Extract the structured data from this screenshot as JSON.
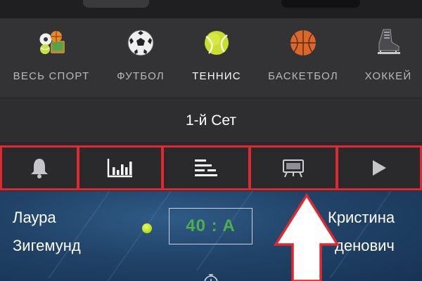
{
  "sports_nav": {
    "items": [
      {
        "label": "ВЕСЬ СПОРТ",
        "icon": "all-sports-icon"
      },
      {
        "label": "ФУТБОЛ",
        "icon": "soccer-ball-icon"
      },
      {
        "label": "ТЕННИС",
        "icon": "tennis-ball-icon",
        "active": true
      },
      {
        "label": "БАСКЕТБОЛ",
        "icon": "basketball-icon"
      },
      {
        "label": "ХОККЕЙ",
        "icon": "hockey-skate-icon"
      }
    ]
  },
  "set_bar": {
    "label": "1-й Сет"
  },
  "action_bar": {
    "items": [
      {
        "icon": "bell-icon"
      },
      {
        "icon": "bar-chart-icon"
      },
      {
        "icon": "list-icon"
      },
      {
        "icon": "scoreboard-icon"
      },
      {
        "icon": "play-icon"
      }
    ],
    "highlight_color": "#e0282f"
  },
  "match": {
    "player_left": {
      "first": "Лаура",
      "last": "Зигемунд"
    },
    "player_right": {
      "first": "Кристина",
      "last": "денович"
    },
    "score": "40 : A",
    "score_color": "#4fb04b"
  },
  "colors": {
    "background": "#2c2c2e",
    "nav_text": "#b9b9bd",
    "nav_text_active": "#ffffff",
    "match_bg": "#214368"
  }
}
